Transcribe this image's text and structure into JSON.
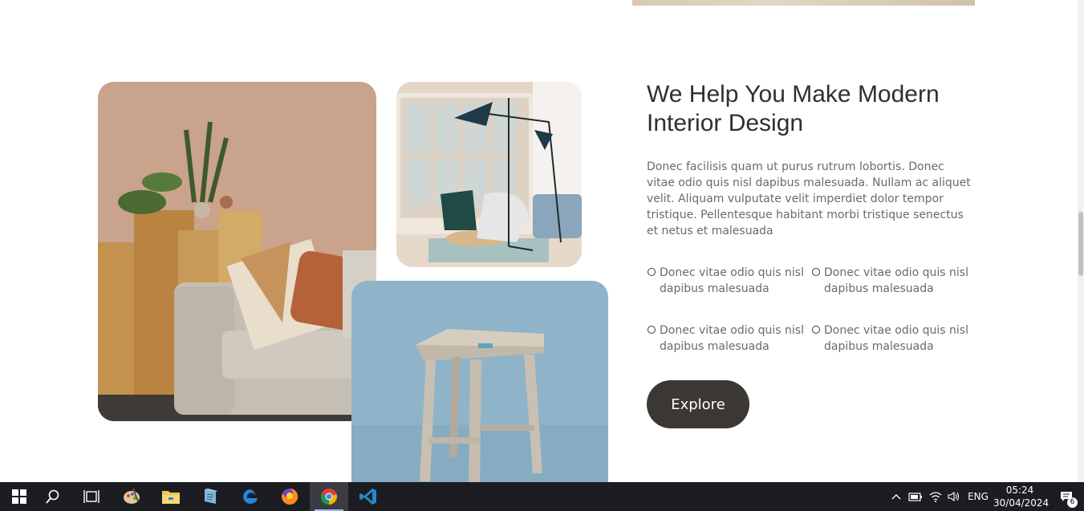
{
  "section": {
    "title": "We Help You Make Modern Interior Design",
    "paragraph": "Donec facilisis quam ut purus rutrum lobortis. Donec vitae odio quis nisl dapibus malesuada. Nullam ac aliquet velit. Aliquam vulputate velit imperdiet dolor tempor tristique. Pellentesque habitant morbi tristique senectus et netus et malesuada",
    "features": [
      "Donec vitae odio quis nisl dapibus malesuada",
      "Donec vitae odio quis nisl dapibus malesuada",
      "Donec vitae odio quis nisl dapibus malesuada",
      "Donec vitae odio quis nisl dapibus malesuada"
    ],
    "button_label": "Explore"
  },
  "taskbar": {
    "apps": [
      "start-icon",
      "search-icon",
      "task-view-icon",
      "paint-icon",
      "file-explorer-icon",
      "notepad-icon",
      "edge-icon",
      "firefox-icon",
      "chrome-icon",
      "vscode-icon"
    ],
    "language": "ENG",
    "time": "05:24",
    "date": "30/04/2024",
    "notification_count": "6"
  },
  "colors": {
    "button_bg": "#3b3833",
    "taskbar_bg": "#1b1d22",
    "text_heading": "#2f2f2f",
    "text_body": "#6a6a6a"
  }
}
